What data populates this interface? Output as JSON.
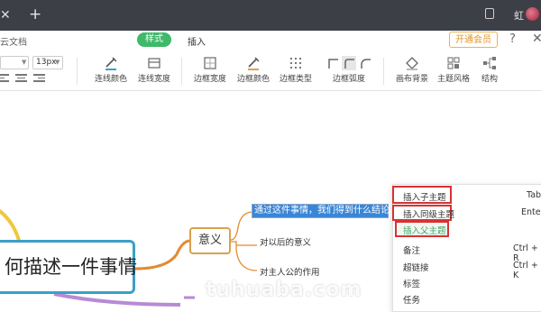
{
  "window": {
    "new_tab": "+",
    "user_name": "虹"
  },
  "menubar": {
    "doc_label": "云文档",
    "tab_style": "样式",
    "tab_insert": "插入",
    "vip_button": "开通会员",
    "help": "?",
    "close": "✕"
  },
  "toolbar": {
    "font_name": "",
    "font_size": "13px",
    "buttons": [
      "连线颜色",
      "连线宽度",
      "边框宽度",
      "边框颜色",
      "边框类型",
      "边框弧度",
      "画布背景",
      "主题风格",
      "结构"
    ]
  },
  "mindmap": {
    "main_topic": "何描述一件事情",
    "branch_topic": "意义",
    "selected_topic": "通过这件事情，我们得到什么结论",
    "leaves": [
      "对以后的意义",
      "对主人公的作用"
    ]
  },
  "context_menu": {
    "items": [
      "插入子主题",
      "插入同级主题",
      "插入父主题",
      "备注",
      "超链接",
      "标签",
      "任务"
    ],
    "shortcuts": [
      "Tab",
      "Enter",
      "",
      "Ctrl + R",
      "Ctrl + K",
      "",
      ""
    ]
  },
  "watermark": "tuhuaba.com",
  "colors": {
    "title_bar": "#3c3f45",
    "accent_green": "#3fb96b",
    "vip_orange": "#e0962a",
    "main_border": "#3aa0c8",
    "branch_orange": "#e38b2e",
    "branch_yellow": "#f0c83c",
    "branch_purple": "#b78ad6",
    "selection_blue": "#3a86d6",
    "highlight_red": "#d83232"
  },
  "icons": [
    "tab-close-icon",
    "plus-icon",
    "window-icon",
    "avatar",
    "help-icon",
    "close-icon",
    "line-color-icon",
    "line-width-icon",
    "border-width-icon",
    "border-color-icon",
    "border-type-icon",
    "border-radius-icon",
    "canvas-background-icon",
    "theme-style-icon",
    "structure-icon",
    "arrow-icon"
  ]
}
